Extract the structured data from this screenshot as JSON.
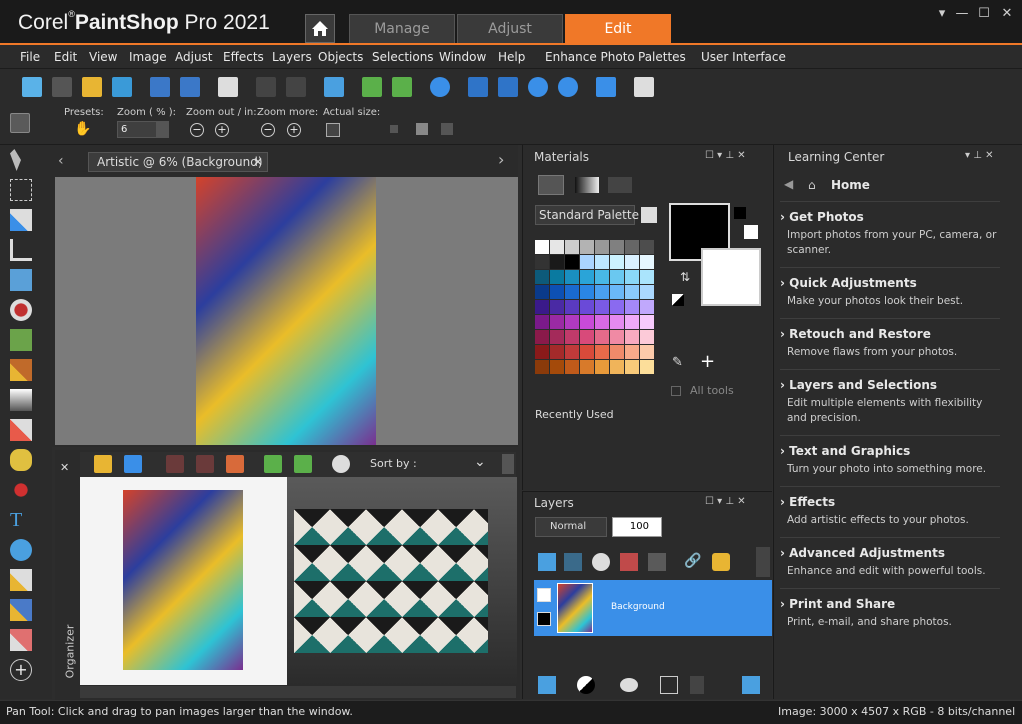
{
  "app": {
    "brand_corel": "Corel",
    "brand_rest": "PaintShop",
    "brand_pro": "Pro 2021",
    "tabs": [
      "Manage",
      "Adjust",
      "Edit"
    ],
    "active_tab": "Edit"
  },
  "menu": [
    "File",
    "Edit",
    "View",
    "Image",
    "Adjust",
    "Effects",
    "Layers",
    "Objects",
    "Selections",
    "Window",
    "Help",
    "Enhance Photo",
    "Palettes",
    "User Interface"
  ],
  "options": {
    "presets_label": "Presets:",
    "zoom_label": "Zoom ( % ):",
    "zoom_value": "6",
    "zoomout_label": "Zoom out / in:",
    "zoommore_label": "Zoom more:",
    "actual_label": "Actual size:"
  },
  "document": {
    "tab_label": "Artistic @   6% (Background)"
  },
  "organizer": {
    "sort_label": "Sort by :",
    "vertical_label": "Organizer"
  },
  "materials": {
    "title": "Materials",
    "palette": "Standard Palette",
    "all_tools": "All tools",
    "recently_used": "Recently Used"
  },
  "layers": {
    "title": "Layers",
    "blend": "Normal",
    "opacity": "100",
    "layer_name": "Background"
  },
  "learning": {
    "title": "Learning Center",
    "home": "Home",
    "items": [
      {
        "title": "Get Photos",
        "desc": "Import photos from your PC, camera, or scanner."
      },
      {
        "title": "Quick Adjustments",
        "desc": "Make your photos look their best."
      },
      {
        "title": "Retouch and Restore",
        "desc": "Remove flaws from your photos."
      },
      {
        "title": "Layers and Selections",
        "desc": "Edit multiple elements with flexibility and precision."
      },
      {
        "title": "Text and Graphics",
        "desc": "Turn your photo into something more."
      },
      {
        "title": "Effects",
        "desc": "Add artistic effects to your photos."
      },
      {
        "title": "Advanced Adjustments",
        "desc": "Enhance and edit with powerful tools."
      },
      {
        "title": "Print and Share",
        "desc": "Print, e-mail, and share photos."
      }
    ]
  },
  "status": {
    "left": "Pan Tool: Click and drag to pan images larger than the window.",
    "right": "Image:  3000 x 4507 x RGB - 8 bits/channel"
  },
  "colors": {
    "accent": "#f07828",
    "selected_layer": "#3a8fe8"
  }
}
